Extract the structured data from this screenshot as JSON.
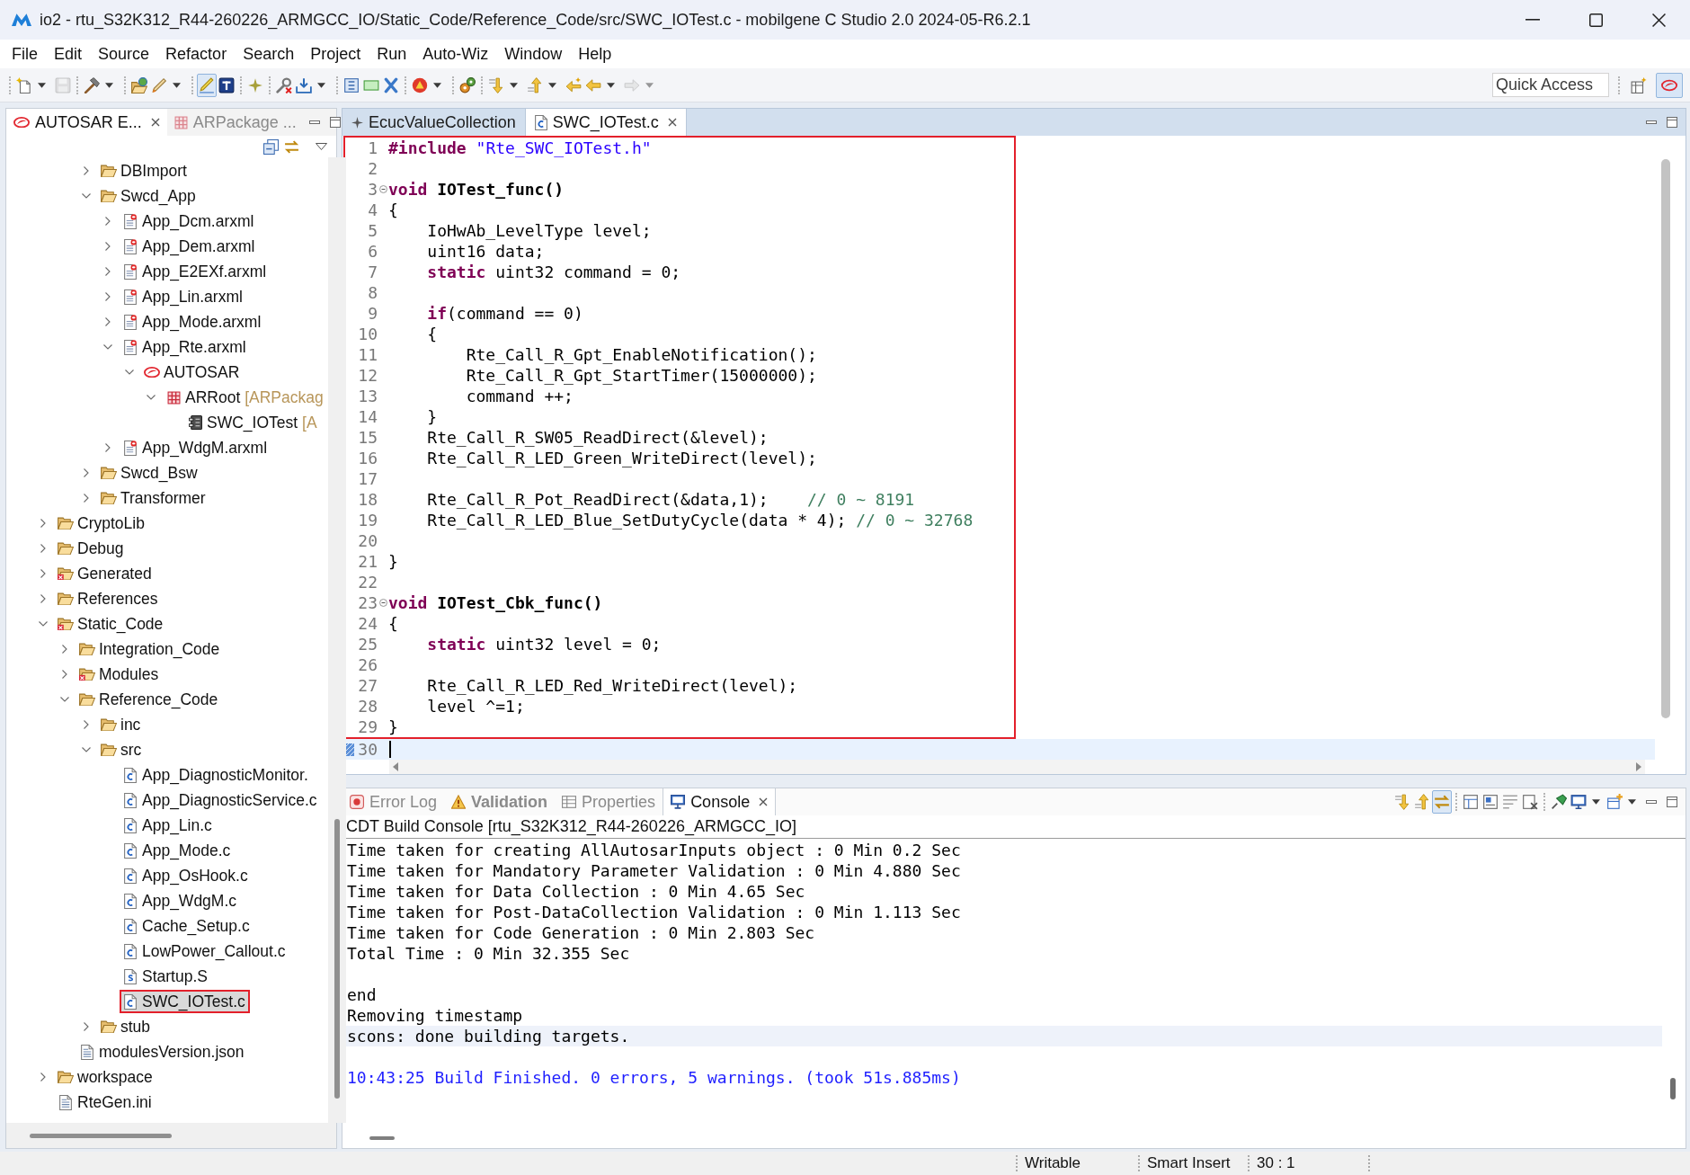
{
  "window": {
    "title": "io2 - rtu_S32K312_R44-260226_ARMGCC_IO/Static_Code/Reference_Code/src/SWC_IOTest.c - mobilgene C Studio 2.0 2024-05-R6.2.1"
  },
  "menu": [
    {
      "label": "File"
    },
    {
      "label": "Edit"
    },
    {
      "label": "Source"
    },
    {
      "label": "Refactor"
    },
    {
      "label": "Search"
    },
    {
      "label": "Project"
    },
    {
      "label": "Run"
    },
    {
      "label": "Auto-Wiz"
    },
    {
      "label": "Window"
    },
    {
      "label": "Help"
    }
  ],
  "toolbar": {
    "groups": [
      [
        {
          "menu": true,
          "disabled": false,
          "pressed": false
        },
        {
          "menu": false,
          "disabled": true,
          "pressed": false
        }
      ],
      [
        {
          "menu": true,
          "disabled": false,
          "pressed": false
        }
      ],
      [
        {
          "menu": false,
          "disabled": false,
          "pressed": false
        },
        {
          "menu": true,
          "disabled": false,
          "pressed": false
        }
      ],
      [
        {
          "menu": false,
          "disabled": false,
          "pressed": true
        },
        {
          "menu": false,
          "disabled": false,
          "pressed": false
        }
      ],
      [
        {
          "menu": false,
          "disabled": false,
          "pressed": false
        }
      ],
      [
        {
          "menu": false,
          "disabled": false,
          "pressed": false
        },
        {
          "menu": true,
          "disabled": false,
          "pressed": false
        }
      ],
      [
        {
          "menu": false,
          "disabled": false,
          "pressed": false
        },
        {
          "menu": false,
          "disabled": false,
          "pressed": false
        },
        {
          "menu": false,
          "disabled": false,
          "pressed": false
        }
      ],
      [
        {
          "menu": true,
          "disabled": false,
          "pressed": false
        }
      ],
      [
        {
          "menu": false,
          "disabled": false,
          "pressed": false
        }
      ],
      [
        {
          "menu": true,
          "disabled": false,
          "pressed": false
        },
        {
          "menu": true,
          "disabled": false,
          "pressed": false
        },
        {
          "menu": false,
          "disabled": false,
          "pressed": false
        },
        {
          "menu": true,
          "disabled": false,
          "pressed": false
        },
        {
          "menu": true,
          "disabled": true,
          "pressed": false
        }
      ]
    ],
    "quick_access": {
      "placeholder": "Quick Access"
    },
    "perspectives": [
      {
        "selected": false
      },
      {
        "selected": true
      }
    ]
  },
  "left_panel": {
    "tabs": [
      {
        "label": "AUTOSAR E...",
        "kind": "autosar",
        "selected": true
      },
      {
        "label": "ARPackage ...",
        "kind": "package",
        "selected": false
      }
    ],
    "tree": [
      {
        "children": [
          {
            "children": [
              {
                "label": "DBImport",
                "kind": "folder",
                "expanded": false,
                "selected": false,
                "framed": false
              },
              {
                "label": "Swcd_App",
                "kind": "folder",
                "expanded": true,
                "selected": false,
                "framed": false,
                "children": [
                  {
                    "label": "App_Dcm.arxml",
                    "kind": "arxml",
                    "expanded": false,
                    "selected": false,
                    "framed": false
                  },
                  {
                    "label": "App_Dem.arxml",
                    "kind": "arxml",
                    "expanded": false,
                    "selected": false,
                    "framed": false
                  },
                  {
                    "label": "App_E2EXf.arxml",
                    "kind": "arxml",
                    "expanded": false,
                    "selected": false,
                    "framed": false
                  },
                  {
                    "label": "App_Lin.arxml",
                    "kind": "arxml",
                    "expanded": false,
                    "selected": false,
                    "framed": false
                  },
                  {
                    "label": "App_Mode.arxml",
                    "kind": "arxml",
                    "expanded": false,
                    "selected": false,
                    "framed": false
                  },
                  {
                    "label": "App_Rte.arxml",
                    "kind": "arxml",
                    "expanded": true,
                    "selected": false,
                    "framed": false,
                    "children": [
                      {
                        "label": "AUTOSAR",
                        "kind": "autosar",
                        "expanded": true,
                        "selected": false,
                        "framed": false,
                        "children": [
                          {
                            "label": "ARRoot",
                            "suffix": "[ARPackag",
                            "kind": "package",
                            "expanded": true,
                            "selected": false,
                            "framed": false,
                            "children": [
                              {
                                "label": "SWC_IOTest",
                                "suffix": "[A",
                                "kind": "component",
                                "selected": false,
                                "framed": false
                              }
                            ]
                          }
                        ]
                      }
                    ]
                  },
                  {
                    "label": "App_WdgM.arxml",
                    "kind": "arxml",
                    "expanded": false,
                    "selected": false,
                    "framed": false
                  }
                ]
              },
              {
                "label": "Swcd_Bsw",
                "kind": "folder",
                "expanded": false,
                "selected": false,
                "framed": false
              },
              {
                "label": "Transformer",
                "kind": "folder",
                "expanded": false,
                "selected": false,
                "framed": false
              }
            ]
          }
        ]
      },
      {
        "label": "CryptoLib",
        "kind": "folder",
        "expanded": false,
        "selected": false,
        "framed": false
      },
      {
        "label": "Debug",
        "kind": "folder",
        "expanded": false,
        "selected": false,
        "framed": false
      },
      {
        "label": "Generated",
        "kind": "error-folder",
        "expanded": false,
        "selected": false,
        "framed": false
      },
      {
        "label": "References",
        "kind": "folder",
        "expanded": false,
        "selected": false,
        "framed": false
      },
      {
        "label": "Static_Code",
        "kind": "error-folder",
        "expanded": true,
        "selected": false,
        "framed": false,
        "children": [
          {
            "label": "Integration_Code",
            "kind": "folder",
            "expanded": false,
            "selected": false,
            "framed": false
          },
          {
            "label": "Modules",
            "kind": "error-folder",
            "expanded": false,
            "selected": false,
            "framed": false
          },
          {
            "label": "Reference_Code",
            "kind": "folder",
            "expanded": true,
            "selected": false,
            "framed": false,
            "children": [
              {
                "label": "inc",
                "kind": "folder",
                "expanded": false,
                "selected": false,
                "framed": false
              },
              {
                "label": "src",
                "kind": "folder",
                "expanded": true,
                "selected": false,
                "framed": false,
                "children": [
                  {
                    "label": "App_DiagnosticMonitor.",
                    "kind": "c-file",
                    "selected": false,
                    "framed": false
                  },
                  {
                    "label": "App_DiagnosticService.c",
                    "kind": "c-file",
                    "selected": false,
                    "framed": false
                  },
                  {
                    "label": "App_Lin.c",
                    "kind": "c-file",
                    "selected": false,
                    "framed": false
                  },
                  {
                    "label": "App_Mode.c",
                    "kind": "c-file",
                    "selected": false,
                    "framed": false
                  },
                  {
                    "label": "App_OsHook.c",
                    "kind": "c-file",
                    "selected": false,
                    "framed": false
                  },
                  {
                    "label": "App_WdgM.c",
                    "kind": "c-file",
                    "selected": false,
                    "framed": false
                  },
                  {
                    "label": "Cache_Setup.c",
                    "kind": "c-file",
                    "selected": false,
                    "framed": false
                  },
                  {
                    "label": "LowPower_Callout.c",
                    "kind": "c-file",
                    "selected": false,
                    "framed": false
                  },
                  {
                    "label": "Startup.S",
                    "kind": "asm-file",
                    "selected": false,
                    "framed": false
                  },
                  {
                    "label": "SWC_IOTest.c",
                    "kind": "c-file",
                    "selected": true,
                    "framed": true
                  }
                ]
              },
              {
                "label": "stub",
                "kind": "folder",
                "expanded": false,
                "selected": false,
                "framed": false
              }
            ]
          },
          {
            "label": "modulesVersion.json",
            "kind": "text-file",
            "selected": false,
            "framed": false
          }
        ]
      },
      {
        "label": "workspace",
        "kind": "folder",
        "expanded": false,
        "selected": false,
        "framed": false
      },
      {
        "label": "RteGen.ini",
        "kind": "text-file",
        "selected": false,
        "framed": false
      }
    ]
  },
  "editor": {
    "tabs": [
      {
        "label": "EcucValueCollection",
        "kind": "ecuc",
        "selected": false
      },
      {
        "label": "SWC_IOTest.c",
        "kind": "c-file",
        "selected": true
      }
    ],
    "blocks": [
      {
        "framed": true,
        "lines": [
          {
            "no": "1",
            "collapsible": false,
            "current": false,
            "tokens": [
              {
                "text": "#include",
                "kind": "keyword"
              },
              {
                "text": " \"Rte_SWC_IOTest.h\"",
                "kind": "string"
              }
            ]
          },
          {
            "no": "2",
            "collapsible": false,
            "current": false
          },
          {
            "no": "3",
            "collapsible": true,
            "current": false,
            "tokens": [
              {
                "text": "void",
                "kind": "keyword"
              },
              {
                "text": " IOTest_func()",
                "kind": "function"
              }
            ]
          },
          {
            "no": "4",
            "collapsible": false,
            "current": false,
            "tokens": [
              {
                "text": "{",
                "kind": "plain"
              }
            ]
          },
          {
            "no": "5",
            "collapsible": false,
            "current": false,
            "tokens": [
              {
                "text": "    IoHwAb_LevelType level;",
                "kind": "plain"
              }
            ]
          },
          {
            "no": "6",
            "collapsible": false,
            "current": false,
            "tokens": [
              {
                "text": "    uint16 data;",
                "kind": "plain"
              }
            ]
          },
          {
            "no": "7",
            "collapsible": false,
            "current": false,
            "tokens": [
              {
                "text": "    static",
                "kind": "keyword"
              },
              {
                "text": " uint32 command = 0;",
                "kind": "plain"
              }
            ]
          },
          {
            "no": "8",
            "collapsible": false,
            "current": false
          },
          {
            "no": "9",
            "collapsible": false,
            "current": false,
            "tokens": [
              {
                "text": "    if",
                "kind": "keyword"
              },
              {
                "text": "(command == 0)",
                "kind": "plain"
              }
            ]
          },
          {
            "no": "10",
            "collapsible": false,
            "current": false,
            "tokens": [
              {
                "text": "    {",
                "kind": "plain"
              }
            ]
          },
          {
            "no": "11",
            "collapsible": false,
            "current": false,
            "tokens": [
              {
                "text": "        Rte_Call_R_Gpt_EnableNotification();",
                "kind": "plain"
              }
            ]
          },
          {
            "no": "12",
            "collapsible": false,
            "current": false,
            "tokens": [
              {
                "text": "        Rte_Call_R_Gpt_StartTimer(15000000);",
                "kind": "plain"
              }
            ]
          },
          {
            "no": "13",
            "collapsible": false,
            "current": false,
            "tokens": [
              {
                "text": "        command ++;",
                "kind": "plain"
              }
            ]
          },
          {
            "no": "14",
            "collapsible": false,
            "current": false,
            "tokens": [
              {
                "text": "    }",
                "kind": "plain"
              }
            ]
          },
          {
            "no": "15",
            "collapsible": false,
            "current": false,
            "tokens": [
              {
                "text": "    Rte_Call_R_SW05_ReadDirect(&level);",
                "kind": "plain"
              }
            ]
          },
          {
            "no": "16",
            "collapsible": false,
            "current": false,
            "tokens": [
              {
                "text": "    Rte_Call_R_LED_Green_WriteDirect(level);",
                "kind": "plain"
              }
            ]
          },
          {
            "no": "17",
            "collapsible": false,
            "current": false
          },
          {
            "no": "18",
            "collapsible": false,
            "current": false,
            "tokens": [
              {
                "text": "    Rte_Call_R_Pot_ReadDirect(&data,1);    ",
                "kind": "plain"
              },
              {
                "text": "// 0 ~ 8191",
                "kind": "comment"
              }
            ]
          },
          {
            "no": "19",
            "collapsible": false,
            "current": false,
            "tokens": [
              {
                "text": "    Rte_Call_R_LED_Blue_SetDutyCycle(data * 4); ",
                "kind": "plain"
              },
              {
                "text": "// 0 ~ 32768",
                "kind": "comment"
              }
            ]
          },
          {
            "no": "20",
            "collapsible": false,
            "current": false
          },
          {
            "no": "21",
            "collapsible": false,
            "current": false,
            "tokens": [
              {
                "text": "}",
                "kind": "plain"
              }
            ]
          },
          {
            "no": "22",
            "collapsible": false,
            "current": false
          },
          {
            "no": "23",
            "collapsible": true,
            "current": false,
            "tokens": [
              {
                "text": "void",
                "kind": "keyword"
              },
              {
                "text": " IOTest_Cbk_func()",
                "kind": "function"
              }
            ]
          },
          {
            "no": "24",
            "collapsible": false,
            "current": false,
            "tokens": [
              {
                "text": "{",
                "kind": "plain"
              }
            ]
          },
          {
            "no": "25",
            "collapsible": false,
            "current": false,
            "tokens": [
              {
                "text": "    static",
                "kind": "keyword"
              },
              {
                "text": " uint32 level = 0;",
                "kind": "plain"
              }
            ]
          },
          {
            "no": "26",
            "collapsible": false,
            "current": false
          },
          {
            "no": "27",
            "collapsible": false,
            "current": false,
            "tokens": [
              {
                "text": "    Rte_Call_R_LED_Red_WriteDirect(level);",
                "kind": "plain"
              }
            ]
          },
          {
            "no": "28",
            "collapsible": false,
            "current": false,
            "tokens": [
              {
                "text": "    level ^=1;",
                "kind": "plain"
              }
            ]
          },
          {
            "no": "29",
            "collapsible": false,
            "current": false,
            "tokens": [
              {
                "text": "}",
                "kind": "plain"
              }
            ]
          }
        ]
      },
      {
        "framed": false,
        "lines": [
          {
            "no": "30",
            "collapsible": false,
            "current": true
          }
        ]
      }
    ]
  },
  "console": {
    "tabs": [
      {
        "label": "Error Log",
        "kind": "error-log",
        "selected": false,
        "updated": false
      },
      {
        "label": "Validation",
        "kind": "validation",
        "selected": false,
        "updated": true
      },
      {
        "label": "Properties",
        "kind": "properties",
        "selected": false,
        "updated": false
      },
      {
        "label": "Console",
        "kind": "console",
        "selected": true,
        "updated": false
      }
    ],
    "toolbar": {
      "groups": [
        [
          {
            "menu": false,
            "pressed": false
          },
          {
            "menu": false,
            "pressed": false
          },
          {
            "menu": false,
            "pressed": true
          }
        ],
        [
          {
            "menu": false,
            "pressed": false
          },
          {
            "menu": false,
            "pressed": false
          },
          {
            "menu": false,
            "pressed": false
          },
          {
            "menu": false,
            "pressed": false
          }
        ],
        [
          {
            "menu": false,
            "pressed": false
          },
          {
            "menu": true,
            "pressed": false
          },
          {
            "menu": true,
            "pressed": false
          }
        ]
      ]
    },
    "title": "CDT Build Console [rtu_S32K312_R44-260226_ARMGCC_IO]",
    "lines": [
      {
        "text": "Time taken for creating AllAutosarInputs object : 0 Min 0.2 Sec",
        "kind": "output",
        "current": false
      },
      {
        "text": "Time taken for Mandatory Parameter Validation : 0 Min 4.880 Sec",
        "kind": "output",
        "current": false
      },
      {
        "text": "Time taken for Data Collection : 0 Min 4.65 Sec",
        "kind": "output",
        "current": false
      },
      {
        "text": "Time taken for Post-DataCollection Validation : 0 Min 1.113 Sec",
        "kind": "output",
        "current": false
      },
      {
        "text": "Time taken for Code Generation : 0 Min 2.803 Sec",
        "kind": "output",
        "current": false
      },
      {
        "text": "Total Time : 0 Min 32.355 Sec",
        "kind": "output",
        "current": false
      },
      {
        "current": false
      },
      {
        "text": "end",
        "kind": "output",
        "current": false
      },
      {
        "text": "Removing timestamp",
        "kind": "output",
        "current": false
      },
      {
        "text": "scons: done building targets.",
        "kind": "output",
        "current": true
      },
      {
        "current": false
      },
      {
        "text": "10:43:25 Build Finished. 0 errors, 5 warnings. (took 51s.885ms)",
        "kind": "info",
        "current": false
      }
    ]
  },
  "status_bar": {
    "fields": [
      "Writable",
      "Smart Insert",
      "30 : 1"
    ]
  }
}
